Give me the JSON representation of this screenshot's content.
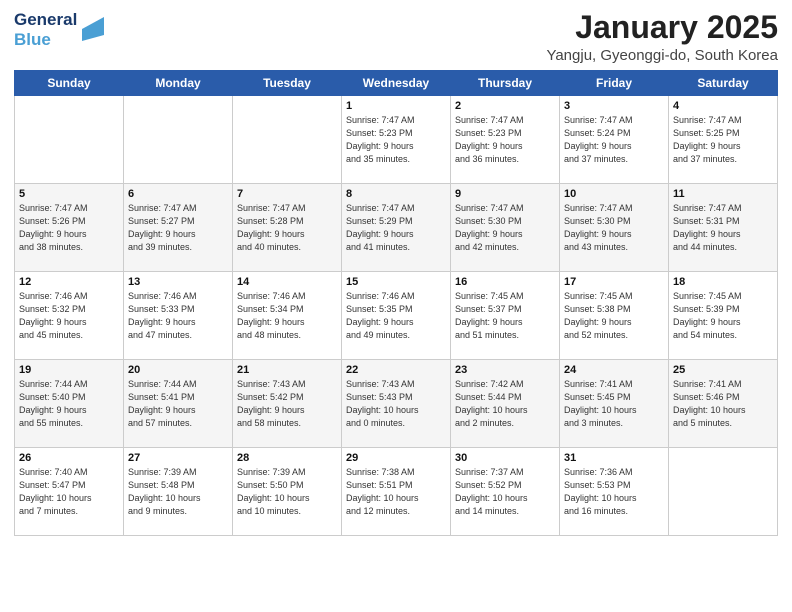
{
  "header": {
    "logo_line1": "General",
    "logo_line2": "Blue",
    "title": "January 2025",
    "subtitle": "Yangju, Gyeonggi-do, South Korea"
  },
  "days_of_week": [
    "Sunday",
    "Monday",
    "Tuesday",
    "Wednesday",
    "Thursday",
    "Friday",
    "Saturday"
  ],
  "weeks": [
    [
      {
        "day": "",
        "info": ""
      },
      {
        "day": "",
        "info": ""
      },
      {
        "day": "",
        "info": ""
      },
      {
        "day": "1",
        "info": "Sunrise: 7:47 AM\nSunset: 5:23 PM\nDaylight: 9 hours\nand 35 minutes."
      },
      {
        "day": "2",
        "info": "Sunrise: 7:47 AM\nSunset: 5:23 PM\nDaylight: 9 hours\nand 36 minutes."
      },
      {
        "day": "3",
        "info": "Sunrise: 7:47 AM\nSunset: 5:24 PM\nDaylight: 9 hours\nand 37 minutes."
      },
      {
        "day": "4",
        "info": "Sunrise: 7:47 AM\nSunset: 5:25 PM\nDaylight: 9 hours\nand 37 minutes."
      }
    ],
    [
      {
        "day": "5",
        "info": "Sunrise: 7:47 AM\nSunset: 5:26 PM\nDaylight: 9 hours\nand 38 minutes."
      },
      {
        "day": "6",
        "info": "Sunrise: 7:47 AM\nSunset: 5:27 PM\nDaylight: 9 hours\nand 39 minutes."
      },
      {
        "day": "7",
        "info": "Sunrise: 7:47 AM\nSunset: 5:28 PM\nDaylight: 9 hours\nand 40 minutes."
      },
      {
        "day": "8",
        "info": "Sunrise: 7:47 AM\nSunset: 5:29 PM\nDaylight: 9 hours\nand 41 minutes."
      },
      {
        "day": "9",
        "info": "Sunrise: 7:47 AM\nSunset: 5:30 PM\nDaylight: 9 hours\nand 42 minutes."
      },
      {
        "day": "10",
        "info": "Sunrise: 7:47 AM\nSunset: 5:30 PM\nDaylight: 9 hours\nand 43 minutes."
      },
      {
        "day": "11",
        "info": "Sunrise: 7:47 AM\nSunset: 5:31 PM\nDaylight: 9 hours\nand 44 minutes."
      }
    ],
    [
      {
        "day": "12",
        "info": "Sunrise: 7:46 AM\nSunset: 5:32 PM\nDaylight: 9 hours\nand 45 minutes."
      },
      {
        "day": "13",
        "info": "Sunrise: 7:46 AM\nSunset: 5:33 PM\nDaylight: 9 hours\nand 47 minutes."
      },
      {
        "day": "14",
        "info": "Sunrise: 7:46 AM\nSunset: 5:34 PM\nDaylight: 9 hours\nand 48 minutes."
      },
      {
        "day": "15",
        "info": "Sunrise: 7:46 AM\nSunset: 5:35 PM\nDaylight: 9 hours\nand 49 minutes."
      },
      {
        "day": "16",
        "info": "Sunrise: 7:45 AM\nSunset: 5:37 PM\nDaylight: 9 hours\nand 51 minutes."
      },
      {
        "day": "17",
        "info": "Sunrise: 7:45 AM\nSunset: 5:38 PM\nDaylight: 9 hours\nand 52 minutes."
      },
      {
        "day": "18",
        "info": "Sunrise: 7:45 AM\nSunset: 5:39 PM\nDaylight: 9 hours\nand 54 minutes."
      }
    ],
    [
      {
        "day": "19",
        "info": "Sunrise: 7:44 AM\nSunset: 5:40 PM\nDaylight: 9 hours\nand 55 minutes."
      },
      {
        "day": "20",
        "info": "Sunrise: 7:44 AM\nSunset: 5:41 PM\nDaylight: 9 hours\nand 57 minutes."
      },
      {
        "day": "21",
        "info": "Sunrise: 7:43 AM\nSunset: 5:42 PM\nDaylight: 9 hours\nand 58 minutes."
      },
      {
        "day": "22",
        "info": "Sunrise: 7:43 AM\nSunset: 5:43 PM\nDaylight: 10 hours\nand 0 minutes."
      },
      {
        "day": "23",
        "info": "Sunrise: 7:42 AM\nSunset: 5:44 PM\nDaylight: 10 hours\nand 2 minutes."
      },
      {
        "day": "24",
        "info": "Sunrise: 7:41 AM\nSunset: 5:45 PM\nDaylight: 10 hours\nand 3 minutes."
      },
      {
        "day": "25",
        "info": "Sunrise: 7:41 AM\nSunset: 5:46 PM\nDaylight: 10 hours\nand 5 minutes."
      }
    ],
    [
      {
        "day": "26",
        "info": "Sunrise: 7:40 AM\nSunset: 5:47 PM\nDaylight: 10 hours\nand 7 minutes."
      },
      {
        "day": "27",
        "info": "Sunrise: 7:39 AM\nSunset: 5:48 PM\nDaylight: 10 hours\nand 9 minutes."
      },
      {
        "day": "28",
        "info": "Sunrise: 7:39 AM\nSunset: 5:50 PM\nDaylight: 10 hours\nand 10 minutes."
      },
      {
        "day": "29",
        "info": "Sunrise: 7:38 AM\nSunset: 5:51 PM\nDaylight: 10 hours\nand 12 minutes."
      },
      {
        "day": "30",
        "info": "Sunrise: 7:37 AM\nSunset: 5:52 PM\nDaylight: 10 hours\nand 14 minutes."
      },
      {
        "day": "31",
        "info": "Sunrise: 7:36 AM\nSunset: 5:53 PM\nDaylight: 10 hours\nand 16 minutes."
      },
      {
        "day": "",
        "info": ""
      }
    ]
  ]
}
